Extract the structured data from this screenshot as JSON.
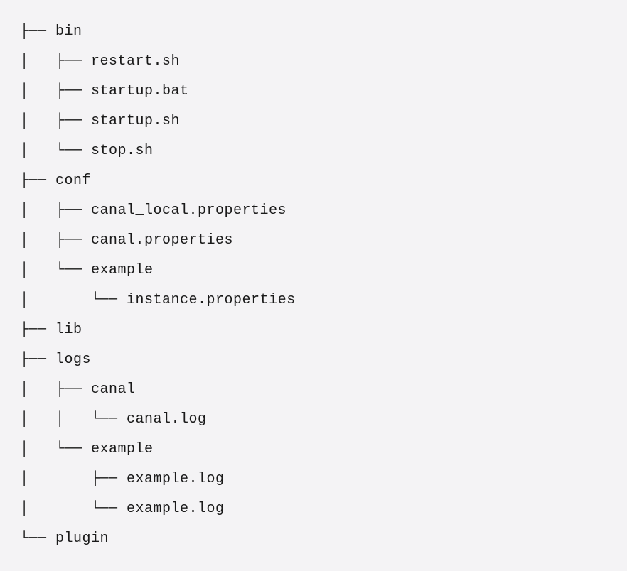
{
  "lines": [
    {
      "prefix": "├── ",
      "name": "bin"
    },
    {
      "prefix": "│   ├── ",
      "name": "restart.sh"
    },
    {
      "prefix": "│   ├── ",
      "name": "startup.bat"
    },
    {
      "prefix": "│   ├── ",
      "name": "startup.sh"
    },
    {
      "prefix": "│   └── ",
      "name": "stop.sh"
    },
    {
      "prefix": "├── ",
      "name": "conf"
    },
    {
      "prefix": "│   ├── ",
      "name": "canal_local.properties"
    },
    {
      "prefix": "│   ├── ",
      "name": "canal.properties"
    },
    {
      "prefix": "│   └── ",
      "name": "example"
    },
    {
      "prefix": "│       └── ",
      "name": "instance.properties"
    },
    {
      "prefix": "├── ",
      "name": "lib"
    },
    {
      "prefix": "├── ",
      "name": "logs"
    },
    {
      "prefix": "│   ├── ",
      "name": "canal"
    },
    {
      "prefix": "│   │   └── ",
      "name": "canal.log"
    },
    {
      "prefix": "│   └── ",
      "name": "example"
    },
    {
      "prefix": "│       ├── ",
      "name": "example.log"
    },
    {
      "prefix": "│       └── ",
      "name": "example.log"
    },
    {
      "prefix": "└── ",
      "name": "plugin"
    }
  ]
}
